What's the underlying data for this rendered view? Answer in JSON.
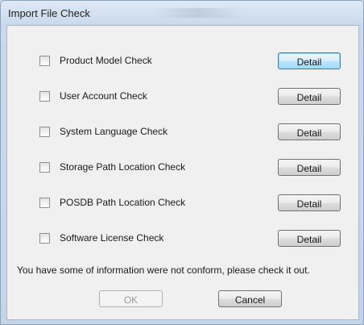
{
  "window": {
    "title": "Import File Check"
  },
  "checks": [
    {
      "label": "Product Model Check",
      "checked": false,
      "button": "Detail"
    },
    {
      "label": "User Account Check",
      "checked": false,
      "button": "Detail"
    },
    {
      "label": "System Language Check",
      "checked": false,
      "button": "Detail"
    },
    {
      "label": "Storage Path Location Check",
      "checked": false,
      "button": "Detail"
    },
    {
      "label": "POSDB Path Location Check",
      "checked": false,
      "button": "Detail"
    },
    {
      "label": "Software License Check",
      "checked": false,
      "button": "Detail"
    }
  ],
  "message": "You have some of information were not conform, please check it out.",
  "buttons": {
    "ok": "OK",
    "cancel": "Cancel"
  }
}
